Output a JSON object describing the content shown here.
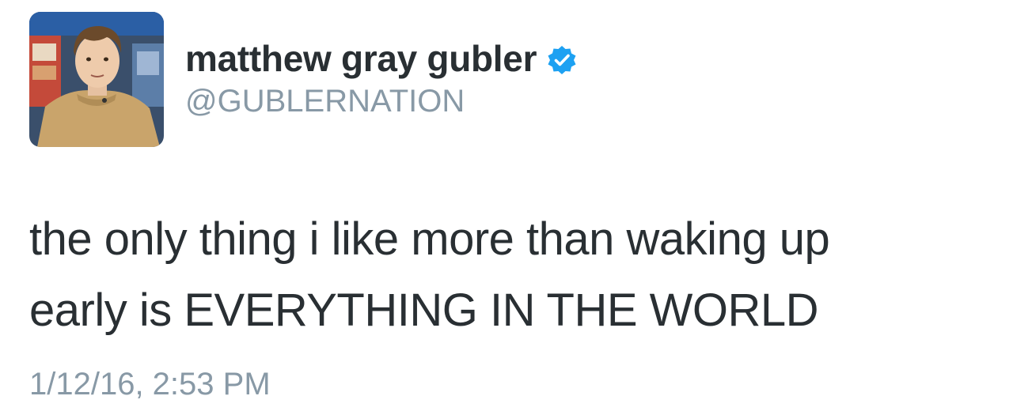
{
  "tweet": {
    "display_name": "matthew gray gubler",
    "handle": "@GUBLERNATION",
    "verified_icon": "verified-badge-icon",
    "text_lines": [
      "the only thing i like more than waking up",
      "early is EVERYTHING IN THE WORLD"
    ],
    "timestamp": "1/12/16, 2:53 PM",
    "colors": {
      "text": "#292f33",
      "secondary": "#8899a6",
      "verified": "#1da1f2"
    }
  }
}
